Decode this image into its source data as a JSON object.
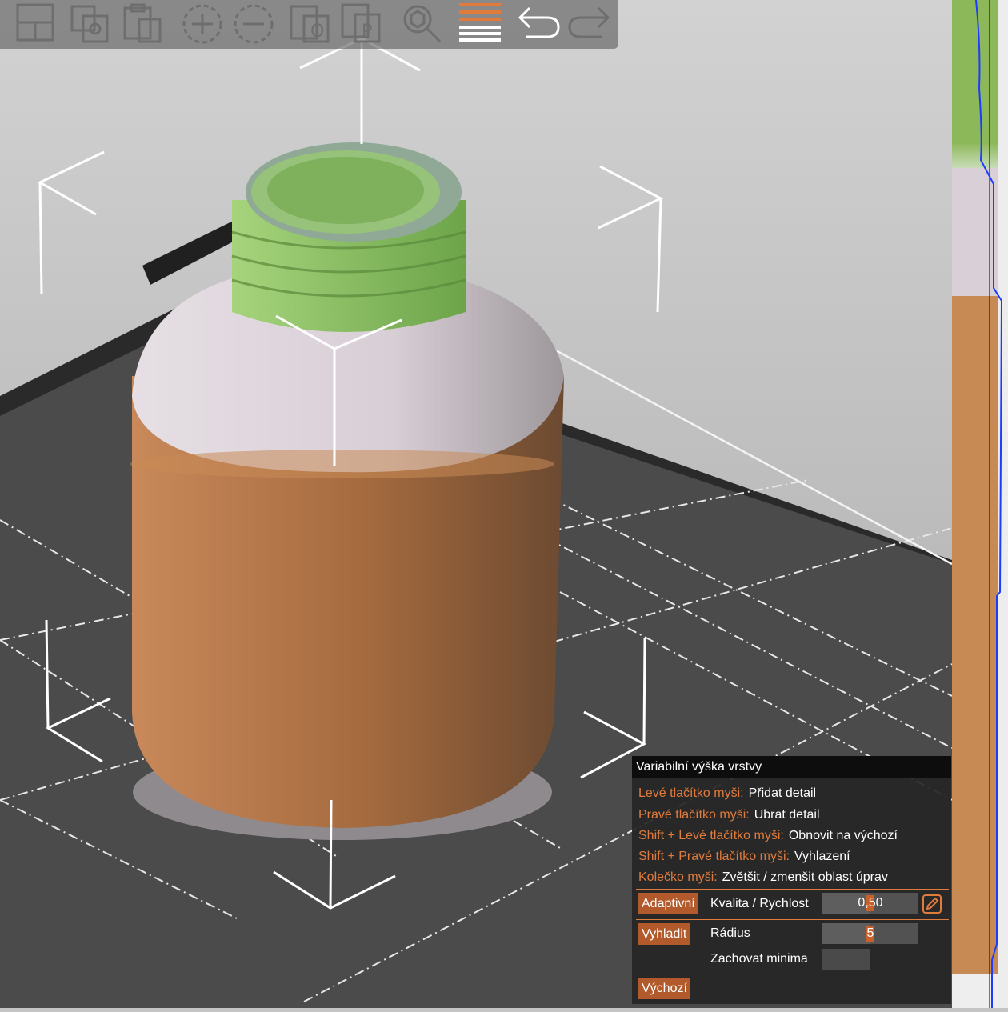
{
  "toolbar": {
    "buttons": [
      {
        "name": "arrange-icon"
      },
      {
        "name": "copy-icon"
      },
      {
        "name": "paste-icon"
      },
      {
        "name": "add-instance-icon"
      },
      {
        "name": "remove-instance-icon"
      },
      {
        "name": "split-to-objects-icon"
      },
      {
        "name": "split-to-parts-icon"
      },
      {
        "name": "search-icon"
      },
      {
        "name": "variable-layer-height-icon",
        "active": true
      },
      {
        "name": "undo-icon"
      },
      {
        "name": "redo-icon"
      }
    ]
  },
  "layer_profile": {
    "colors": {
      "top": "#8db85a",
      "middle": "#d9cfd6",
      "bottom": "#c88a55",
      "curve": "#1c3cff"
    }
  },
  "panel": {
    "title": "Variabilní výška vrstvy",
    "hints": [
      {
        "key": "Levé tlačítko myši:",
        "action": "Přidat detail"
      },
      {
        "key": "Pravé tlačítko myši:",
        "action": "Ubrat detail"
      },
      {
        "key": "Shift + Levé tlačítko myši:",
        "action": "Obnovit na výchozí"
      },
      {
        "key": "Shift + Pravé tlačítko myši:",
        "action": "Vyhlazení"
      },
      {
        "key": "Kolečko myši:",
        "action": "Zvětšit / zmenšit oblast úprav"
      }
    ],
    "adaptive_button": "Adaptivní",
    "quality_label": "Kvalita / Rychlost",
    "quality_value": "0,50",
    "quality_fraction": 0.5,
    "smooth_button": "Vyhladit",
    "radius_label": "Rádius",
    "radius_value": "5",
    "radius_fraction": 0.5,
    "keep_min_label": "Zachovat minima",
    "default_button": "Výchozí",
    "accent_color": "#e07b3c"
  }
}
